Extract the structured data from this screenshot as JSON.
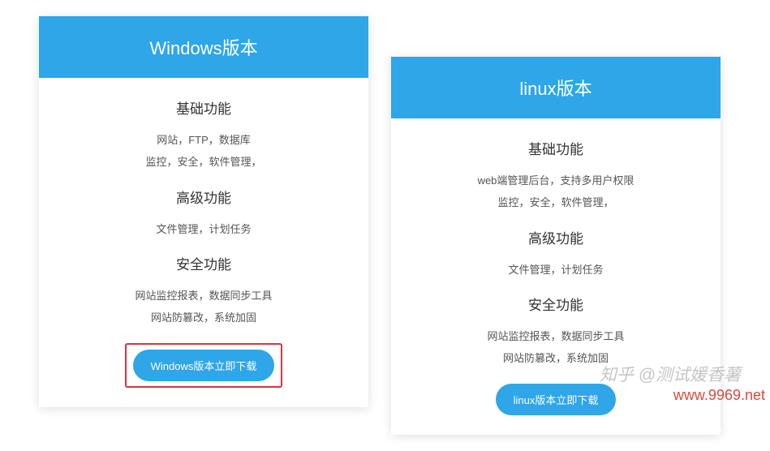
{
  "cards": [
    {
      "title": "Windows版本",
      "sections": [
        {
          "heading": "基础功能",
          "lines": [
            "网站，FTP，数据库",
            "监控，安全，软件管理，"
          ]
        },
        {
          "heading": "高级功能",
          "lines": [
            "文件管理，计划任务"
          ]
        },
        {
          "heading": "安全功能",
          "lines": [
            "网站监控报表，数据同步工具",
            "网站防篡改，系统加固"
          ]
        }
      ],
      "button": "Windows版本立即下载",
      "highlighted": true
    },
    {
      "title": "linux版本",
      "sections": [
        {
          "heading": "基础功能",
          "lines": [
            "web端管理后台，支持多用户权限",
            "监控，安全，软件管理，"
          ]
        },
        {
          "heading": "高级功能",
          "lines": [
            "文件管理，计划任务"
          ]
        },
        {
          "heading": "安全功能",
          "lines": [
            "网站监控报表，数据同步工具",
            "网站防篡改，系统加固"
          ]
        }
      ],
      "button": "linux版本立即下载",
      "highlighted": false
    }
  ],
  "watermark_zh": "知乎 @测试媛香薯",
  "watermark_url": "www.9969.net"
}
